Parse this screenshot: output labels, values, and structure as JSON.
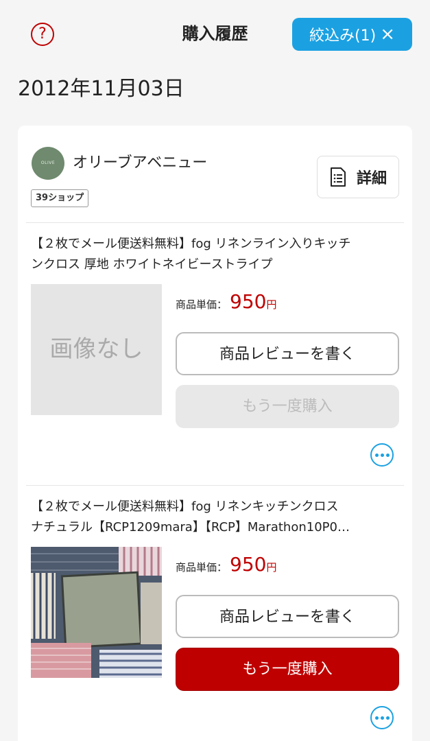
{
  "header": {
    "title": "購入履歴",
    "help_glyph": "?",
    "filter_label": "絞込み(1)",
    "filter_clear_glyph": "×"
  },
  "order": {
    "date": "2012年11月03日",
    "shop": {
      "logo_text": "OLIVE AVENUE",
      "name": "オリーブアベニュー",
      "badge": "39ショップ",
      "detail_label": "詳細"
    },
    "items": [
      {
        "title_line1": "【２枚でメール便送料無料】fog リネンライン入りキッチ",
        "title_line2": "ンクロス 厚地 ホワイトネイビーストライプ",
        "image_placeholder": "画像なし",
        "price_label": "商品単価：",
        "price": "950",
        "currency": "円",
        "review_label": "商品レビューを書く",
        "rebuy_label": "もう一度購入",
        "rebuy_enabled": false
      },
      {
        "title_line1": "【２枚でメール便送料無料】fog リネンキッチンクロス",
        "title_line2": "ナチュラル【RCP1209mara】【RCP】Marathon10P0…",
        "image_placeholder": "",
        "price_label": "商品単価：",
        "price": "950",
        "currency": "円",
        "review_label": "商品レビューを書く",
        "rebuy_label": "もう一度購入",
        "rebuy_enabled": true
      }
    ]
  },
  "colors": {
    "accent_blue": "#1ba1e2",
    "price_red": "#bf0000",
    "rebuy_red": "#bf0000"
  }
}
